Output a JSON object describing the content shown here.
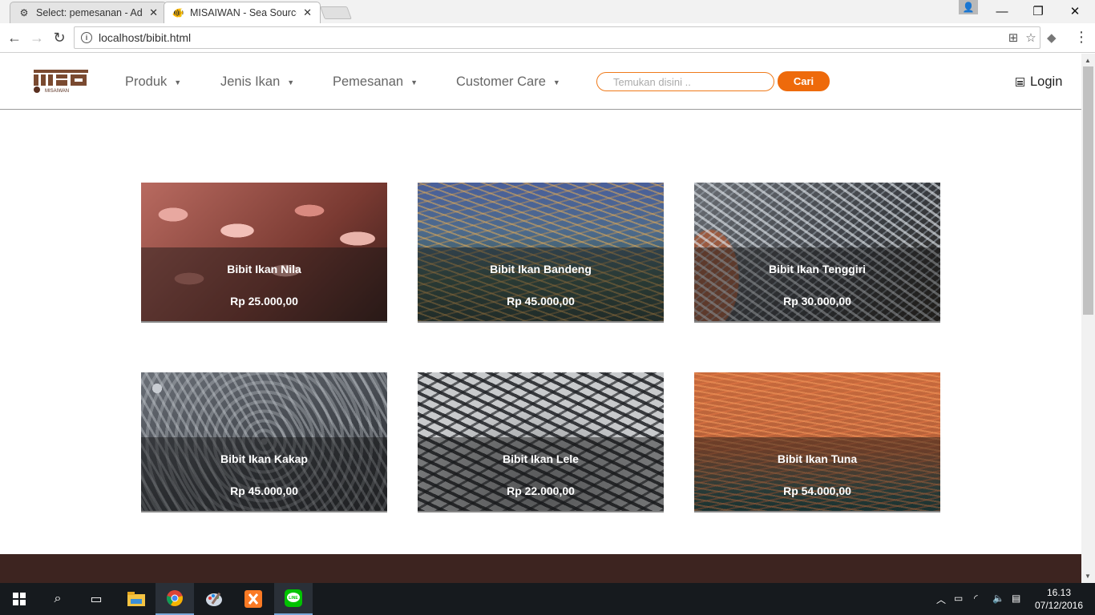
{
  "browser": {
    "tabs": [
      {
        "title": "Select: pemesanan - Adm",
        "active": false
      },
      {
        "title": "MISAIWAN - Sea Source",
        "active": true
      }
    ],
    "url": "localhost/bibit.html"
  },
  "site": {
    "logo_text": "MISAIWAN",
    "nav": [
      {
        "label": "Produk"
      },
      {
        "label": "Jenis Ikan"
      },
      {
        "label": "Pemesanan"
      },
      {
        "label": "Customer Care"
      }
    ],
    "search": {
      "placeholder": "Temukan disini .."
    },
    "search_button": "Cari",
    "login_label": "Login",
    "colors": {
      "accent": "#ee6a0b",
      "footer": "#3d2420"
    }
  },
  "products": [
    {
      "name": "Bibit Ikan Nila",
      "price": "Rp 25.000,00"
    },
    {
      "name": "Bibit Ikan Bandeng",
      "price": "Rp 45.000,00"
    },
    {
      "name": "Bibit Ikan Tenggiri",
      "price": "Rp 30.000,00"
    },
    {
      "name": "Bibit Ikan Kakap",
      "price": "Rp 45.000,00"
    },
    {
      "name": "Bibit Ikan Lele",
      "price": "Rp 22.000,00"
    },
    {
      "name": "Bibit Ikan Tuna",
      "price": "Rp 54.000,00"
    }
  ],
  "taskbar": {
    "time": "16.13",
    "date": "07/12/2016"
  }
}
